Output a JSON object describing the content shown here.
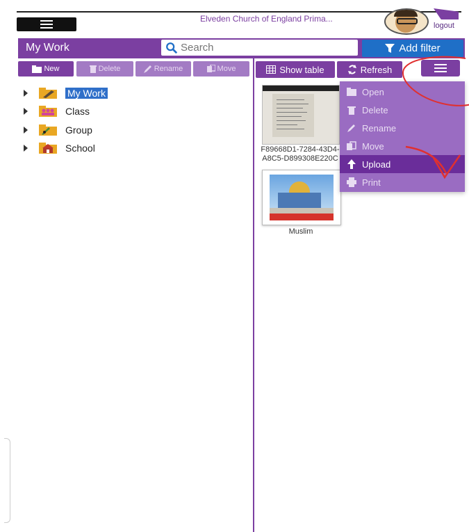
{
  "topbar": {
    "school_name": "Elveden Church of England Prima...",
    "logout_label": "logout"
  },
  "header": {
    "title": "My Work",
    "search_placeholder": "Search",
    "filter_label": "Add filter"
  },
  "left_toolbar": {
    "new_label": "New",
    "delete_label": "Delete",
    "rename_label": "Rename",
    "move_label": "Move"
  },
  "tree": {
    "items": [
      {
        "label": "My Work"
      },
      {
        "label": "Class"
      },
      {
        "label": "Group"
      },
      {
        "label": "School"
      }
    ]
  },
  "right_toolbar": {
    "show_table_label": "Show table",
    "refresh_label": "Refresh"
  },
  "files": [
    {
      "caption": "F89668D1-7284-43D4-A8C5-D899308E220C"
    },
    {
      "caption": "Muslim"
    }
  ],
  "menu": {
    "items": [
      {
        "label": "Open",
        "icon": "folder-open-icon"
      },
      {
        "label": "Delete",
        "icon": "trash-icon"
      },
      {
        "label": "Rename",
        "icon": "pencil-icon"
      },
      {
        "label": "Move",
        "icon": "move-icon"
      },
      {
        "label": "Upload",
        "icon": "upload-arrow-icon"
      },
      {
        "label": "Print",
        "icon": "printer-icon"
      }
    ]
  },
  "colors": {
    "primary_purple": "#7b3fa1",
    "filter_blue": "#1f6fc7",
    "selection_blue": "#2f6fc9",
    "annotation_red": "#e03030"
  }
}
